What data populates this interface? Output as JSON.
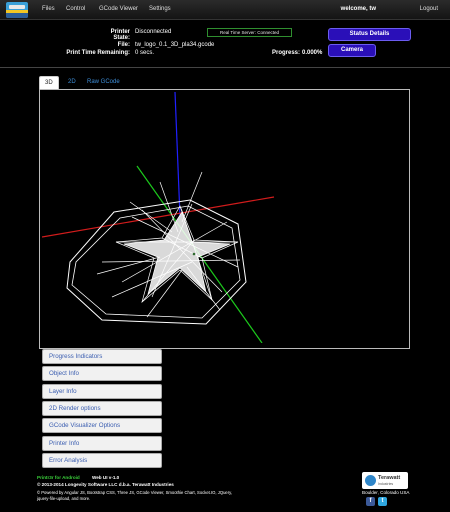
{
  "nav": {
    "items": [
      "Files",
      "Control",
      "GCode Viewer",
      "Settings"
    ],
    "welcome": "welcome, tw",
    "logout": "Logout"
  },
  "status": {
    "printer_state_label": "Printer State:",
    "printer_state_value": "Disconnected",
    "file_label": "File:",
    "file_value": "tw_logo_0.1_3D_pla34.gcode",
    "time_label": "Print Time Remaining:",
    "time_value": "0 secs.",
    "progress_label": "Progress:",
    "progress_value": "0.000%",
    "realtime_server": "Real Time Server: Connected",
    "status_details_button": "Status Details",
    "camera_button": "Camera"
  },
  "tabs": [
    "3D",
    "2D",
    "Raw GCode"
  ],
  "accordion": [
    "Progress Indicators",
    "Object Info",
    "Layer Info",
    "2D Render options",
    "GCode Visualizer Options",
    "Printer Info",
    "Error Analysis"
  ],
  "footer": {
    "app_name": "Printr3r for Android",
    "version": "Web UI v-1.0",
    "copyright": "© 2013-2014 Longevity Software LLC d.b.a. Terawatt Industries",
    "powered_by_1": "© Powered by Angular JS, Bootstrap CSS, Three JS, GCode Viewer, Smoothie Chart, Socket.IO, JQuery,",
    "powered_by_2": "jquery-file-upload, and more.",
    "company": "Terawatt",
    "company_sub": "Industries",
    "location": "Boulder, Colorado  USA"
  },
  "colors": {
    "accent_blue": "#2a0fb8",
    "link_blue": "#3e8ed8",
    "app_name_green": "#3ad13a"
  }
}
